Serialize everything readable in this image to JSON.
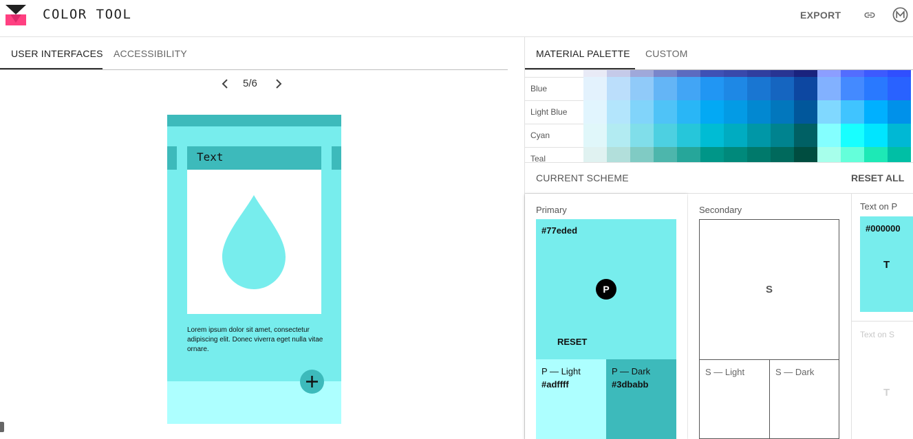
{
  "header": {
    "app_title": "COLOR TOOL",
    "export_label": "EXPORT",
    "logo_colors": {
      "top": "#212121",
      "bottom": "#ff4081"
    }
  },
  "left": {
    "tabs": [
      {
        "label": "USER INTERFACES",
        "active": true
      },
      {
        "label": "ACCESSIBILITY",
        "active": false
      }
    ],
    "pager": {
      "label": "5/6"
    },
    "phone": {
      "title": "Text",
      "body": "Lorem ipsum dolor sit amet, consectetur adipiscing elit. Donec viverra eget nulla vitae ornare."
    }
  },
  "right": {
    "tabs": [
      {
        "label": "MATERIAL PALETTE",
        "active": true
      },
      {
        "label": "CUSTOM",
        "active": false
      }
    ],
    "palette": {
      "header_row": [
        "#e8eaf6",
        "#c5cae9",
        "#9fa8da",
        "#7986cb",
        "#5c6bc0",
        "#3f51b5",
        "#3949ab",
        "#303f9f",
        "#283593",
        "#1a237e",
        "#8c9eff",
        "#536dfe",
        "#3d5afe",
        "#304ffe"
      ],
      "rows": [
        {
          "name": "Blue",
          "swatches": [
            "#e3f2fd",
            "#bbdefb",
            "#90caf9",
            "#64b5f6",
            "#42a5f5",
            "#2196f3",
            "#1e88e5",
            "#1976d2",
            "#1565c0",
            "#0d47a1",
            "#82b1ff",
            "#448aff",
            "#2979ff",
            "#2962ff"
          ]
        },
        {
          "name": "Light Blue",
          "swatches": [
            "#e1f5fe",
            "#b3e5fc",
            "#81d4fa",
            "#4fc3f7",
            "#29b6f6",
            "#03a9f4",
            "#039be5",
            "#0288d1",
            "#0277bd",
            "#01579b",
            "#80d8ff",
            "#40c4ff",
            "#00b0ff",
            "#0091ea"
          ]
        },
        {
          "name": "Cyan",
          "swatches": [
            "#e0f7fa",
            "#b2ebf2",
            "#80deea",
            "#4dd0e1",
            "#26c6da",
            "#00bcd4",
            "#00acc1",
            "#0097a7",
            "#00838f",
            "#006064",
            "#84ffff",
            "#18ffff",
            "#00e5ff",
            "#00b8d4"
          ]
        },
        {
          "name": "Teal",
          "swatches": [
            "#e0f2f1",
            "#b2dfdb",
            "#80cbc4",
            "#4db6ac",
            "#26a69a",
            "#009688",
            "#00897b",
            "#00796b",
            "#00695c",
            "#004d40",
            "#a7ffeb",
            "#64ffda",
            "#1de9b6",
            "#00bfa5"
          ]
        }
      ]
    },
    "scheme": {
      "title": "CURRENT SCHEME",
      "reset_all": "RESET ALL",
      "primary": {
        "label": "Primary",
        "hex": "#77eded",
        "badge": "P",
        "reset": "RESET",
        "light": {
          "name": "P — Light",
          "hex": "#adffff"
        },
        "dark": {
          "name": "P — Dark",
          "hex": "#3dbabb"
        }
      },
      "secondary": {
        "label": "Secondary",
        "letter": "S",
        "light": {
          "name": "S — Light"
        },
        "dark": {
          "name": "S — Dark"
        }
      },
      "text_on_p": {
        "label": "Text on P",
        "hex": "#000000",
        "letter": "T"
      },
      "text_on_s": {
        "label": "Text on S",
        "letter": "T"
      }
    }
  }
}
